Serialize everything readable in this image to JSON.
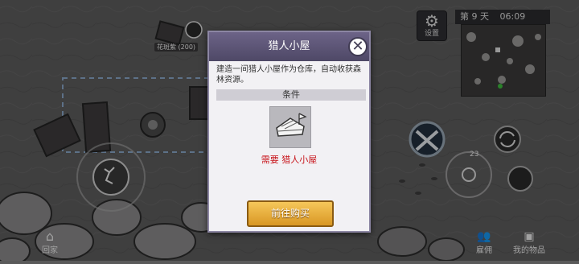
{
  "hud": {
    "settings_label": "设置",
    "day_label": "第 9 天",
    "time": "06:09",
    "plot_label": "花斑紫 (200)",
    "home_label": "回家",
    "hire_label": "雇佣",
    "items_label": "我的物品",
    "ammo_count": "23"
  },
  "dialog": {
    "title": "猎人小屋",
    "close_icon": "close-icon",
    "description": "建造一间猎人小屋作为仓库，自动收获森林资源。",
    "condition_header": "条件",
    "requirement_text": "需要 猎人小屋",
    "buy_button": "前往购买"
  }
}
